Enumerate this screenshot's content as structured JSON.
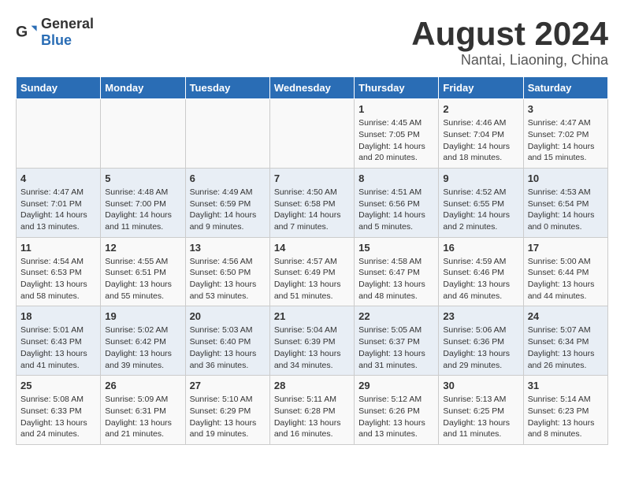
{
  "logo": {
    "text_general": "General",
    "text_blue": "Blue"
  },
  "title": "August 2024",
  "subtitle": "Nantai, Liaoning, China",
  "days_of_week": [
    "Sunday",
    "Monday",
    "Tuesday",
    "Wednesday",
    "Thursday",
    "Friday",
    "Saturday"
  ],
  "weeks": [
    [
      {
        "day": "",
        "info": ""
      },
      {
        "day": "",
        "info": ""
      },
      {
        "day": "",
        "info": ""
      },
      {
        "day": "",
        "info": ""
      },
      {
        "day": "1",
        "info": "Sunrise: 4:45 AM\nSunset: 7:05 PM\nDaylight: 14 hours\nand 20 minutes."
      },
      {
        "day": "2",
        "info": "Sunrise: 4:46 AM\nSunset: 7:04 PM\nDaylight: 14 hours\nand 18 minutes."
      },
      {
        "day": "3",
        "info": "Sunrise: 4:47 AM\nSunset: 7:02 PM\nDaylight: 14 hours\nand 15 minutes."
      }
    ],
    [
      {
        "day": "4",
        "info": "Sunrise: 4:47 AM\nSunset: 7:01 PM\nDaylight: 14 hours\nand 13 minutes."
      },
      {
        "day": "5",
        "info": "Sunrise: 4:48 AM\nSunset: 7:00 PM\nDaylight: 14 hours\nand 11 minutes."
      },
      {
        "day": "6",
        "info": "Sunrise: 4:49 AM\nSunset: 6:59 PM\nDaylight: 14 hours\nand 9 minutes."
      },
      {
        "day": "7",
        "info": "Sunrise: 4:50 AM\nSunset: 6:58 PM\nDaylight: 14 hours\nand 7 minutes."
      },
      {
        "day": "8",
        "info": "Sunrise: 4:51 AM\nSunset: 6:56 PM\nDaylight: 14 hours\nand 5 minutes."
      },
      {
        "day": "9",
        "info": "Sunrise: 4:52 AM\nSunset: 6:55 PM\nDaylight: 14 hours\nand 2 minutes."
      },
      {
        "day": "10",
        "info": "Sunrise: 4:53 AM\nSunset: 6:54 PM\nDaylight: 14 hours\nand 0 minutes."
      }
    ],
    [
      {
        "day": "11",
        "info": "Sunrise: 4:54 AM\nSunset: 6:53 PM\nDaylight: 13 hours\nand 58 minutes."
      },
      {
        "day": "12",
        "info": "Sunrise: 4:55 AM\nSunset: 6:51 PM\nDaylight: 13 hours\nand 55 minutes."
      },
      {
        "day": "13",
        "info": "Sunrise: 4:56 AM\nSunset: 6:50 PM\nDaylight: 13 hours\nand 53 minutes."
      },
      {
        "day": "14",
        "info": "Sunrise: 4:57 AM\nSunset: 6:49 PM\nDaylight: 13 hours\nand 51 minutes."
      },
      {
        "day": "15",
        "info": "Sunrise: 4:58 AM\nSunset: 6:47 PM\nDaylight: 13 hours\nand 48 minutes."
      },
      {
        "day": "16",
        "info": "Sunrise: 4:59 AM\nSunset: 6:46 PM\nDaylight: 13 hours\nand 46 minutes."
      },
      {
        "day": "17",
        "info": "Sunrise: 5:00 AM\nSunset: 6:44 PM\nDaylight: 13 hours\nand 44 minutes."
      }
    ],
    [
      {
        "day": "18",
        "info": "Sunrise: 5:01 AM\nSunset: 6:43 PM\nDaylight: 13 hours\nand 41 minutes."
      },
      {
        "day": "19",
        "info": "Sunrise: 5:02 AM\nSunset: 6:42 PM\nDaylight: 13 hours\nand 39 minutes."
      },
      {
        "day": "20",
        "info": "Sunrise: 5:03 AM\nSunset: 6:40 PM\nDaylight: 13 hours\nand 36 minutes."
      },
      {
        "day": "21",
        "info": "Sunrise: 5:04 AM\nSunset: 6:39 PM\nDaylight: 13 hours\nand 34 minutes."
      },
      {
        "day": "22",
        "info": "Sunrise: 5:05 AM\nSunset: 6:37 PM\nDaylight: 13 hours\nand 31 minutes."
      },
      {
        "day": "23",
        "info": "Sunrise: 5:06 AM\nSunset: 6:36 PM\nDaylight: 13 hours\nand 29 minutes."
      },
      {
        "day": "24",
        "info": "Sunrise: 5:07 AM\nSunset: 6:34 PM\nDaylight: 13 hours\nand 26 minutes."
      }
    ],
    [
      {
        "day": "25",
        "info": "Sunrise: 5:08 AM\nSunset: 6:33 PM\nDaylight: 13 hours\nand 24 minutes."
      },
      {
        "day": "26",
        "info": "Sunrise: 5:09 AM\nSunset: 6:31 PM\nDaylight: 13 hours\nand 21 minutes."
      },
      {
        "day": "27",
        "info": "Sunrise: 5:10 AM\nSunset: 6:29 PM\nDaylight: 13 hours\nand 19 minutes."
      },
      {
        "day": "28",
        "info": "Sunrise: 5:11 AM\nSunset: 6:28 PM\nDaylight: 13 hours\nand 16 minutes."
      },
      {
        "day": "29",
        "info": "Sunrise: 5:12 AM\nSunset: 6:26 PM\nDaylight: 13 hours\nand 13 minutes."
      },
      {
        "day": "30",
        "info": "Sunrise: 5:13 AM\nSunset: 6:25 PM\nDaylight: 13 hours\nand 11 minutes."
      },
      {
        "day": "31",
        "info": "Sunrise: 5:14 AM\nSunset: 6:23 PM\nDaylight: 13 hours\nand 8 minutes."
      }
    ]
  ]
}
